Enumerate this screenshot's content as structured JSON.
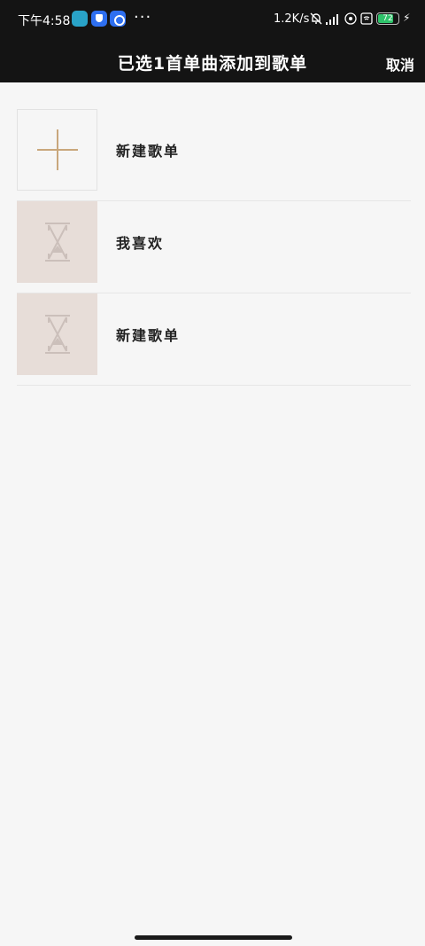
{
  "status_bar": {
    "time": "下午4:58",
    "notification_icons": [
      "calendar-app-icon",
      "shield-app-icon",
      "browser-app-icon"
    ],
    "more": "···",
    "net_speed": "1.2K/s",
    "battery_level": "72"
  },
  "header": {
    "title": "已选1首单曲添加到歌单",
    "cancel_label": "取消"
  },
  "playlists": [
    {
      "label": "新建歌单",
      "cover": "plus-icon"
    },
    {
      "label": "我喜欢",
      "cover": "hourglass-icon"
    },
    {
      "label": "新建歌单",
      "cover": "hourglass-icon"
    }
  ],
  "colors": {
    "bar_background": "#141414",
    "page_background": "#f6f6f6",
    "plus_icon": "#c9a77c",
    "placeholder_cover": "#e7ddd8",
    "battery": "#2ec26a"
  }
}
